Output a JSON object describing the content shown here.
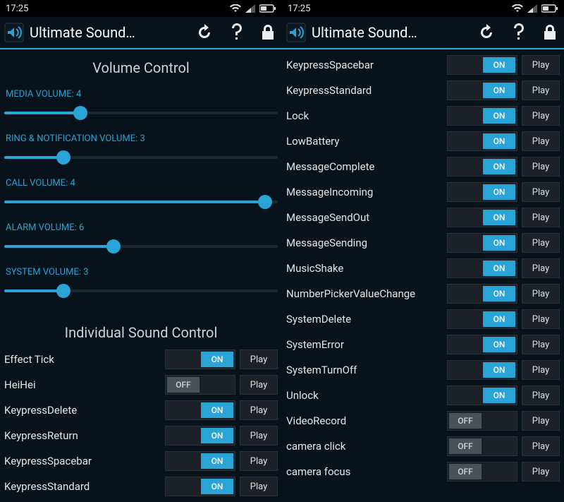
{
  "status": {
    "time": "17:25"
  },
  "app": {
    "title": "Ultimate Sound…"
  },
  "sections": {
    "volume": "Volume Control",
    "individual": "Individual Sound Control"
  },
  "sliders": {
    "media": {
      "label": "MEDIA VOLUME: 4",
      "pct": 28
    },
    "ring": {
      "label": "RING & NOTIFICATION VOLUME: 3",
      "pct": 22
    },
    "call": {
      "label": "CALL VOLUME: 4",
      "pct": 95
    },
    "alarm": {
      "label": "ALARM VOLUME: 6",
      "pct": 40
    },
    "system": {
      "label": "SYSTEM VOLUME: 3",
      "pct": 22
    }
  },
  "left_items": [
    {
      "label": "Effect Tick",
      "state": "ON"
    },
    {
      "label": "HeiHei",
      "state": "OFF"
    },
    {
      "label": "KeypressDelete",
      "state": "ON"
    },
    {
      "label": "KeypressReturn",
      "state": "ON"
    },
    {
      "label": "KeypressSpacebar",
      "state": "ON"
    },
    {
      "label": "KeypressStandard",
      "state": "ON"
    }
  ],
  "right_items": [
    {
      "label": "KeypressSpacebar",
      "state": "ON"
    },
    {
      "label": "KeypressStandard",
      "state": "ON"
    },
    {
      "label": "Lock",
      "state": "ON"
    },
    {
      "label": "LowBattery",
      "state": "ON"
    },
    {
      "label": "MessageComplete",
      "state": "ON"
    },
    {
      "label": "MessageIncoming",
      "state": "ON"
    },
    {
      "label": "MessageSendOut",
      "state": "ON"
    },
    {
      "label": "MessageSending",
      "state": "ON"
    },
    {
      "label": "MusicShake",
      "state": "ON"
    },
    {
      "label": "NumberPickerValueChange",
      "state": "ON"
    },
    {
      "label": "SystemDelete",
      "state": "ON"
    },
    {
      "label": "SystemError",
      "state": "ON"
    },
    {
      "label": "SystemTurnOff",
      "state": "ON"
    },
    {
      "label": "Unlock",
      "state": "ON"
    },
    {
      "label": "VideoRecord",
      "state": "OFF"
    },
    {
      "label": "camera click",
      "state": "OFF"
    },
    {
      "label": "camera focus",
      "state": "OFF"
    }
  ],
  "buttons": {
    "play": "Play",
    "on": "ON",
    "off": "OFF"
  }
}
